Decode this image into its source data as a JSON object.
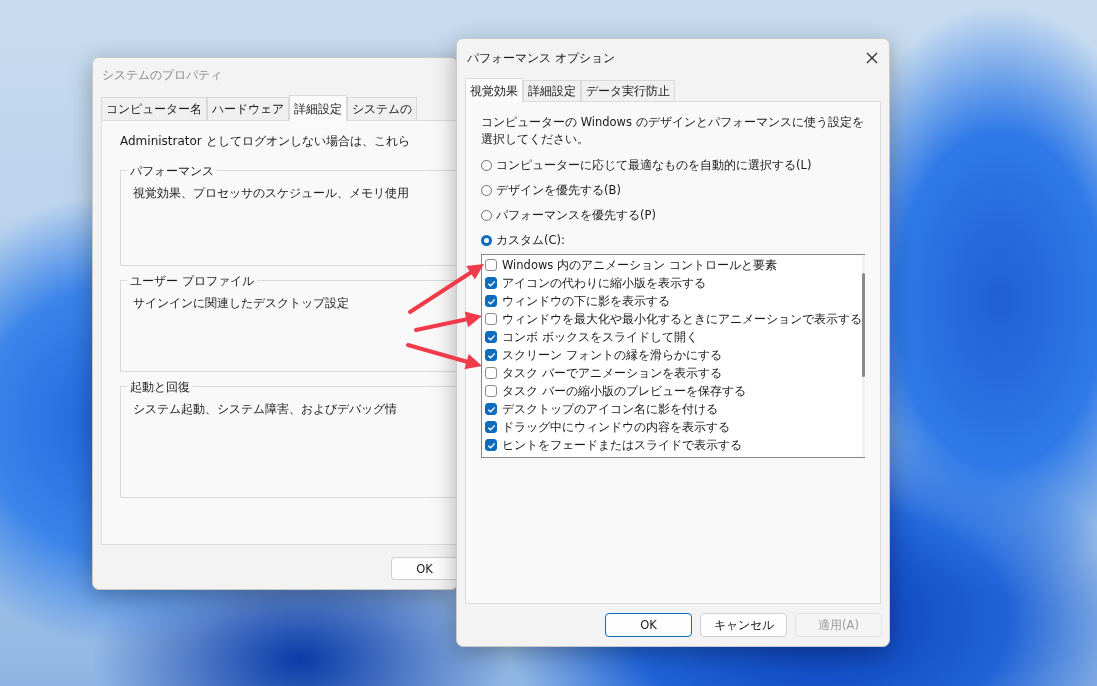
{
  "back_window": {
    "title": "システムのプロパティ",
    "tabs": [
      {
        "label": "コンピューター名",
        "selected": false
      },
      {
        "label": "ハードウェア",
        "selected": false
      },
      {
        "label": "詳細設定",
        "selected": true
      },
      {
        "label": "システムの",
        "selected": false
      }
    ],
    "intro": "Administrator としてログオンしない場合は、これら",
    "groups": [
      {
        "title": "パフォーマンス",
        "text": "視覚効果、プロセッサのスケジュール、メモリ使用"
      },
      {
        "title": "ユーザー プロファイル",
        "text": "サインインに関連したデスクトップ設定"
      },
      {
        "title": "起動と回復",
        "text": "システム起動、システム障害、およびデバッグ情"
      }
    ],
    "buttons": [
      "OK"
    ]
  },
  "front_window": {
    "title": "パフォーマンス オプション",
    "tabs": [
      {
        "label": "視覚効果",
        "selected": true
      },
      {
        "label": "詳細設定",
        "selected": false
      },
      {
        "label": "データ実行防止",
        "selected": false
      }
    ],
    "description": "コンピューターの Windows のデザインとパフォーマンスに使う設定を選択してください。",
    "options": [
      {
        "label": "コンピューターに応じて最適なものを自動的に選択する(L)",
        "selected": false
      },
      {
        "label": "デザインを優先する(B)",
        "selected": false
      },
      {
        "label": "パフォーマンスを優先する(P)",
        "selected": false
      },
      {
        "label": "カスタム(C):",
        "selected": true
      }
    ],
    "effects": [
      {
        "label": "Windows 内のアニメーション コントロールと要素",
        "checked": false
      },
      {
        "label": "アイコンの代わりに縮小版を表示する",
        "checked": true
      },
      {
        "label": "ウィンドウの下に影を表示する",
        "checked": true
      },
      {
        "label": "ウィンドウを最大化や最小化するときにアニメーションで表示する",
        "checked": false
      },
      {
        "label": "コンボ ボックスをスライドして開く",
        "checked": true
      },
      {
        "label": "スクリーン フォントの縁を滑らかにする",
        "checked": true
      },
      {
        "label": "タスク バーでアニメーションを表示する",
        "checked": false
      },
      {
        "label": "タスク バーの縮小版のプレビューを保存する",
        "checked": false
      },
      {
        "label": "デスクトップのアイコン名に影を付ける",
        "checked": true
      },
      {
        "label": "ドラッグ中にウィンドウの内容を表示する",
        "checked": true
      },
      {
        "label": "ヒントをフェードまたはスライドで表示する",
        "checked": true
      }
    ],
    "buttons": [
      {
        "label": "OK",
        "default": true,
        "disabled": false
      },
      {
        "label": "キャンセル",
        "default": false,
        "disabled": false
      },
      {
        "label": "適用(A)",
        "default": false,
        "disabled": true
      }
    ]
  }
}
